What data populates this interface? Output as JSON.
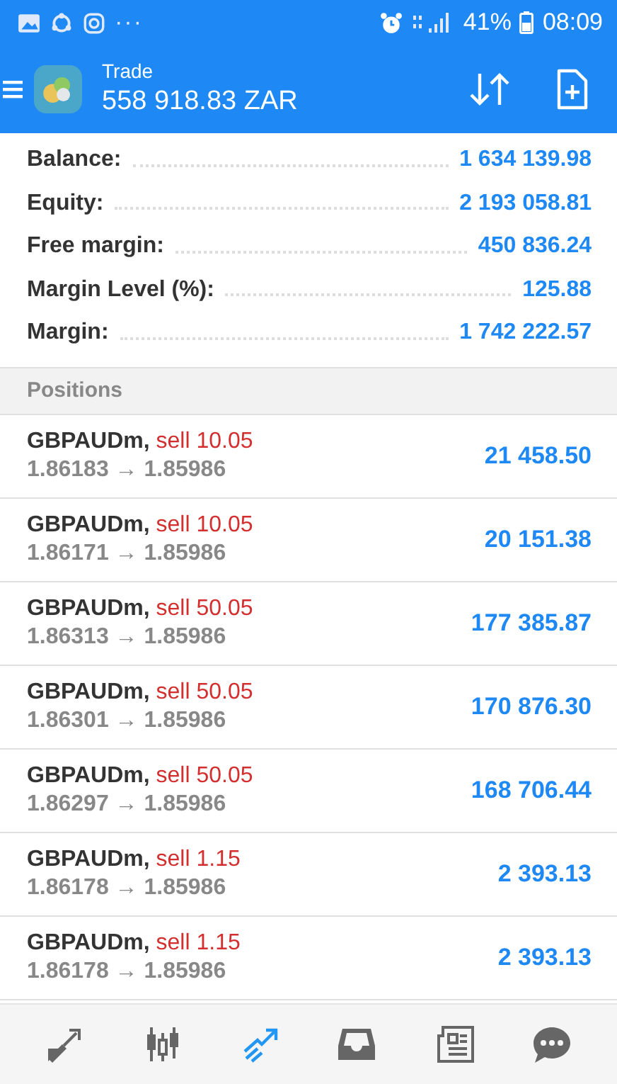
{
  "status_bar": {
    "dots": "···",
    "battery": "41%",
    "time": "08:09"
  },
  "header": {
    "title": "Trade",
    "balance": "558 918.83 ZAR"
  },
  "summary": [
    {
      "label": "Balance:",
      "value": "1 634 139.98"
    },
    {
      "label": "Equity:",
      "value": "2 193 058.81"
    },
    {
      "label": "Free margin:",
      "value": "450 836.24"
    },
    {
      "label": "Margin Level (%):",
      "value": "125.88"
    },
    {
      "label": "Margin:",
      "value": "1 742 222.57"
    }
  ],
  "positions": {
    "heading": "Positions",
    "rows": [
      {
        "symbol": "GBPAUDm,",
        "side": "sell 10.05",
        "open": "1.86183",
        "arrow": "→",
        "current": "1.85986",
        "profit": "21 458.50"
      },
      {
        "symbol": "GBPAUDm,",
        "side": "sell 10.05",
        "open": "1.86171",
        "arrow": "→",
        "current": "1.85986",
        "profit": "20 151.38"
      },
      {
        "symbol": "GBPAUDm,",
        "side": "sell 50.05",
        "open": "1.86313",
        "arrow": "→",
        "current": "1.85986",
        "profit": "177 385.87"
      },
      {
        "symbol": "GBPAUDm,",
        "side": "sell 50.05",
        "open": "1.86301",
        "arrow": "→",
        "current": "1.85986",
        "profit": "170 876.30"
      },
      {
        "symbol": "GBPAUDm,",
        "side": "sell 50.05",
        "open": "1.86297",
        "arrow": "→",
        "current": "1.85986",
        "profit": "168 706.44"
      },
      {
        "symbol": "GBPAUDm,",
        "side": "sell 1.15",
        "open": "1.86178",
        "arrow": "→",
        "current": "1.85986",
        "profit": "2 393.13"
      },
      {
        "symbol": "GBPAUDm,",
        "side": "sell 1.15",
        "open": "1.86178",
        "arrow": "→",
        "current": "1.85986",
        "profit": "2 393.13"
      }
    ]
  },
  "nav": [
    {
      "kind": "quotes",
      "selected": false
    },
    {
      "kind": "chart",
      "selected": false
    },
    {
      "kind": "trade",
      "selected": true
    },
    {
      "kind": "history",
      "selected": false
    },
    {
      "kind": "news",
      "selected": false
    },
    {
      "kind": "chat",
      "selected": false
    }
  ]
}
